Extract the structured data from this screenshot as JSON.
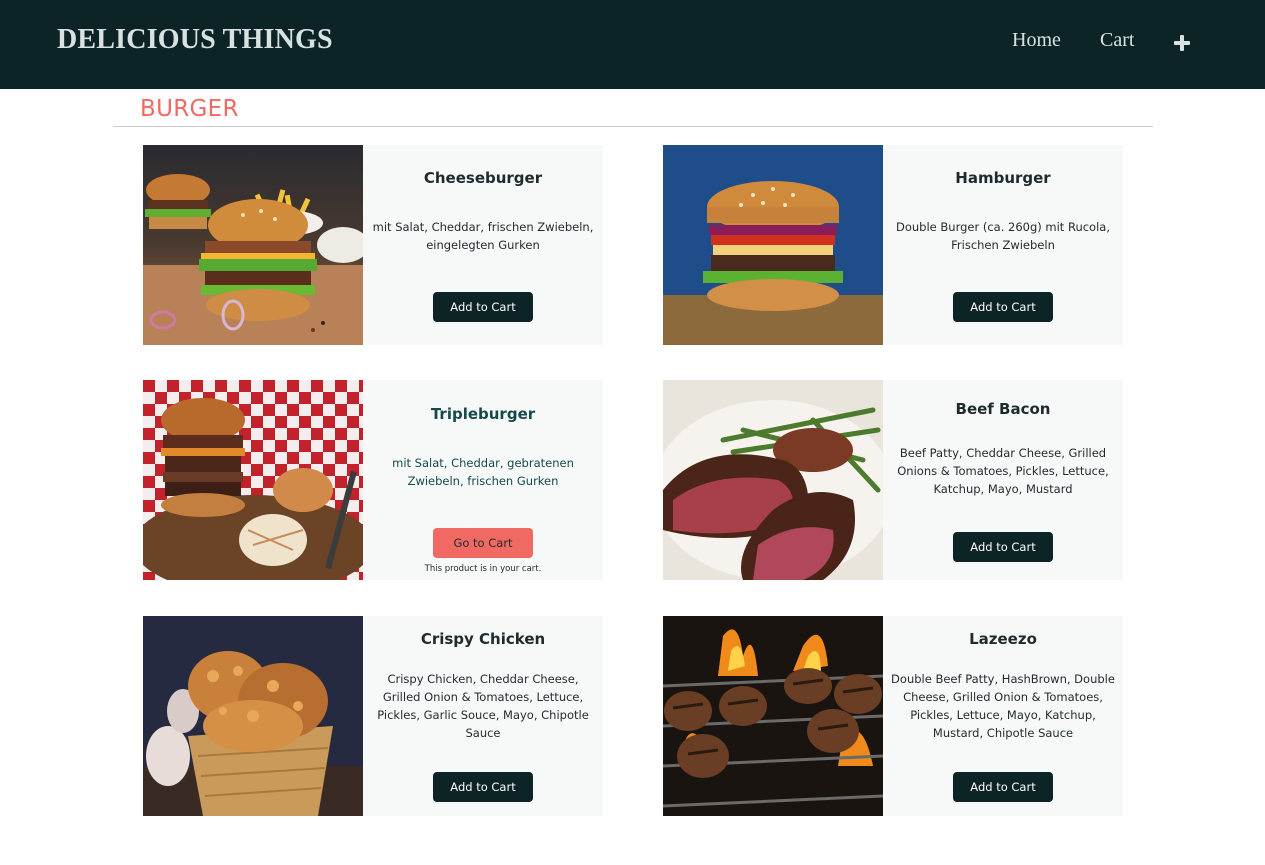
{
  "header": {
    "brand": "DELICIOUS THINGS",
    "nav": {
      "home": "Home",
      "cart": "Cart",
      "add_icon": "plus-icon"
    }
  },
  "section": {
    "title": "BURGER"
  },
  "products": [
    {
      "name": "Cheeseburger",
      "description": "mit Salat, Cheddar, frischen Zwiebeln, eingelegten Gurken",
      "button": "Add to Cart"
    },
    {
      "name": "Hamburger",
      "description": "Double Burger (ca. 260g) mit Rucola, Frischen Zwiebeln",
      "button": "Add to Cart"
    },
    {
      "name": "Tripleburger",
      "description": "mit Salat, Cheddar, gebratenen Zwiebeln, frischen Gurken",
      "button": "Go to Cart",
      "note": "This product is in your cart."
    },
    {
      "name": "Beef Bacon",
      "description": "Beef Patty, Cheddar Cheese, Grilled Onions & Tomatoes, Pickles, Lettuce, Katchup, Mayo, Mustard",
      "button": "Add to Cart"
    },
    {
      "name": "Crispy Chicken",
      "description": "Crispy Chicken, Cheddar Cheese, Grilled Onion & Tomatoes, Lettuce, Pickles, Garlic Souce, Mayo, Chipotle Sauce",
      "button": "Add to Cart"
    },
    {
      "name": "Lazeezo",
      "description": "Double Beef Patty, HashBrown, Double Cheese, Grilled Onion & Tomatoes, Pickles, Lettuce, Mayo, Katchup, Mustard, Chipotle Sauce",
      "button": "Add to Cart"
    }
  ],
  "colors": {
    "navbar": "#0d2427",
    "accent": "#f06a63",
    "card_bg": "#f7f9f9",
    "button": "#0d2427"
  }
}
